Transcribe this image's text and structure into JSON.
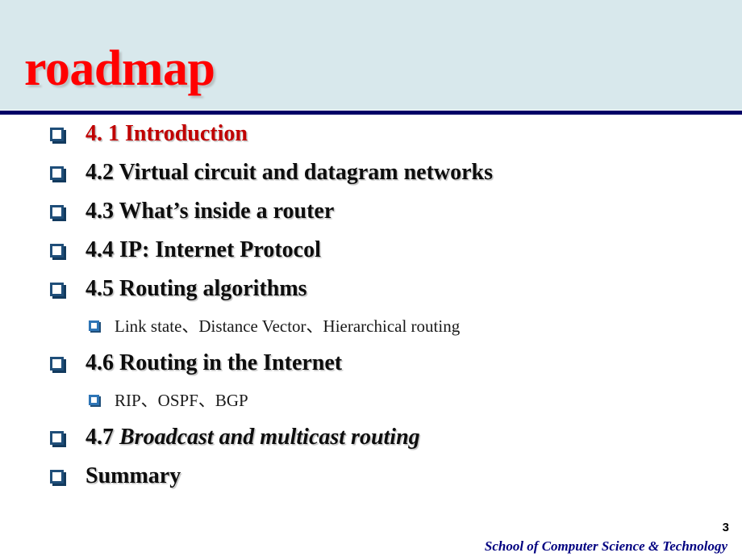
{
  "slide": {
    "title": "roadmap",
    "title_color": "#FF0000",
    "band_color": "#D8E8EC",
    "rule_color": "#000066",
    "accent_color": "#C00000",
    "bullet_color": "#1F4E79",
    "footer_color": "#000080"
  },
  "outline": [
    {
      "level": 1,
      "text": "4. 1 Introduction",
      "style": "accent"
    },
    {
      "level": 1,
      "text": "4.2 Virtual circuit and datagram networks",
      "style": "normal"
    },
    {
      "level": 1,
      "text": "4.3 What’s inside a router",
      "style": "normal"
    },
    {
      "level": 1,
      "text": "4.4 IP: Internet Protocol",
      "style": "normal"
    },
    {
      "level": 1,
      "text": "4.5 Routing algorithms",
      "style": "normal"
    },
    {
      "level": 2,
      "text": "Link state、Distance Vector、Hierarchical routing",
      "style": "normal"
    },
    {
      "level": 1,
      "text": "4.6 Routing in the Internet",
      "style": "normal"
    },
    {
      "level": 2,
      "text": "RIP、OSPF、BGP",
      "style": "normal"
    },
    {
      "level": 1,
      "text_prefix": "4.7 ",
      "text_italic": "Broadcast and multicast routing",
      "style": "italic-tail"
    },
    {
      "level": 1,
      "text": "Summary",
      "style": "normal"
    }
  ],
  "footer": {
    "organization": "School of Computer Science & Technology",
    "page_number": "3"
  }
}
